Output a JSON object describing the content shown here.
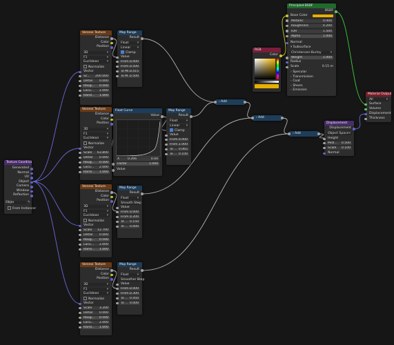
{
  "tex_coord": {
    "title": "Texture Coordinate",
    "outputs": [
      "Generated",
      "Normal",
      "UV",
      "Object",
      "Camera",
      "Window",
      "Reflection"
    ],
    "object_label": "Objec",
    "from_instancer": "From Instancer"
  },
  "voronoi": [
    {
      "title": "Voronoi Texture",
      "outputs": [
        "Distance",
        "Color",
        "Position"
      ],
      "dim": "3D",
      "feature": "F1",
      "metric": "Euclidean",
      "normalize": "Normalize",
      "vector_label": "Vector",
      "fields": [
        [
          "Sc...",
          "200.000"
        ],
        [
          "Detail",
          "0.000"
        ],
        [
          "Roug...",
          "0.500"
        ],
        [
          "Lacu...",
          "2.000"
        ],
        [
          "Rand...",
          "1.000"
        ]
      ]
    },
    {
      "title": "Voronoi Texture",
      "outputs": [
        "Distance",
        "Color",
        "Position"
      ],
      "dim": "3D",
      "feature": "F1",
      "metric": "Euclidean",
      "normalize": "Normalize",
      "vector_label": "Vector",
      "fields": [
        [
          "Scale",
          "63.800"
        ],
        [
          "Detail",
          "0.000"
        ],
        [
          "Roug...",
          "0.500"
        ],
        [
          "Lacu...",
          "2.000"
        ],
        [
          "Rand...",
          "1.000"
        ]
      ]
    },
    {
      "title": "Voronoi Texture",
      "outputs": [
        "Distance",
        "Color",
        "Position"
      ],
      "dim": "3D",
      "feature": "F1",
      "metric": "Euclidean",
      "normalize": "Normalize",
      "vector_label": "Vector",
      "fields": [
        [
          "Scale",
          "12.700"
        ],
        [
          "Detail",
          "0.000"
        ],
        [
          "Roug...",
          "0.500"
        ],
        [
          "Lacu...",
          "2.000"
        ],
        [
          "Rand...",
          "1.000"
        ]
      ]
    },
    {
      "title": "Voronoi Texture",
      "outputs": [
        "Distance",
        "Color",
        "Position"
      ],
      "dim": "3D",
      "feature": "F1",
      "metric": "Euclidean",
      "normalize": "Normalize",
      "vector_label": "Vector",
      "fields": [
        [
          "Scale",
          "3.200"
        ],
        [
          "Detail",
          "0.000"
        ],
        [
          "Roug...",
          "0.500"
        ],
        [
          "Lacu...",
          "2.000"
        ],
        [
          "Rand...",
          "1.000"
        ]
      ]
    }
  ],
  "map_range": [
    {
      "title": "Map Range",
      "result": "Result",
      "dtype": "Float",
      "interp": "Linear",
      "clamp": "Clamp",
      "value_label": "Value",
      "fields": [
        [
          "From...",
          "0.000"
        ],
        [
          "From...",
          "0.500"
        ],
        [
          "To Mi...",
          "0.415"
        ],
        [
          "To M...",
          "0.500"
        ]
      ]
    },
    {
      "title": "Map Range",
      "result": "Result",
      "dtype": "Float",
      "interp": "Linear",
      "clamp": "Clamp",
      "value_label": "Value",
      "fields": [
        [
          "From...",
          "0.000"
        ],
        [
          "From...",
          "1.000"
        ],
        [
          "To ...",
          "0.065"
        ],
        [
          "To ...",
          "0.100"
        ]
      ]
    },
    {
      "title": "Map Range",
      "result": "Result",
      "dtype": "Float",
      "interp": "Smooth Step",
      "clamp": "",
      "value_label": "Value",
      "fields": [
        [
          "From...",
          "0.000"
        ],
        [
          "From...",
          "0.200"
        ],
        [
          "To ...",
          "0.150"
        ],
        [
          "To ...",
          "0.000"
        ]
      ]
    },
    {
      "title": "Map Range",
      "result": "Result",
      "dtype": "Float",
      "interp": "Smoother Step",
      "clamp": "",
      "value_label": "Value",
      "fields": [
        [
          "From...",
          "0.000"
        ],
        [
          "From...",
          "0.300"
        ],
        [
          "To ...",
          "0.450"
        ],
        [
          "To ...",
          "0.000"
        ]
      ]
    }
  ],
  "float_curve": {
    "title": "Float Curve",
    "value_out": "Value",
    "x_label": "X",
    "x_val": "0.266",
    "y_val": "0.00",
    "factor_label": "Factor",
    "factor_val": "1.000",
    "value_in": "Value"
  },
  "add_nodes": [
    {
      "title": "Add"
    },
    {
      "title": "Add"
    },
    {
      "title": "Add"
    }
  ],
  "rgb": {
    "title": "RGB",
    "color_label": "Color"
  },
  "bsdf": {
    "title": "Principled BSDF",
    "out": "BSDF",
    "fields": [
      [
        "Base Color",
        ""
      ],
      [
        "Metallic",
        "0.000"
      ],
      [
        "Roughness",
        "0.200"
      ],
      [
        "IOR",
        "1.500"
      ],
      [
        "Alpha",
        "1.000"
      ]
    ],
    "normal": "Normal",
    "subsurface": "Subsurface",
    "method": "Christensen-Burley",
    "weight": [
      "Weight",
      "1.000"
    ],
    "radius": "Radius",
    "scale": [
      "Scale",
      "0.15 m"
    ],
    "panels": [
      "Specular",
      "Transmission",
      "Coat",
      "Sheen",
      "Emission"
    ]
  },
  "displacement": {
    "title": "Displacement",
    "out": "Displacement",
    "space": "Object Space",
    "height": "Height",
    "fields": [
      [
        "Midl...",
        "0.500"
      ],
      [
        "Scale",
        "0.100"
      ]
    ],
    "normal": "Normal"
  },
  "material_output": {
    "title": "Material Output",
    "target": "All",
    "inputs": [
      "Surface",
      "Volume",
      "Displacement",
      "Thickness"
    ]
  },
  "colors": {
    "wire": "#b5b5b5",
    "vector_wire": "#6a6ad8",
    "shader_wire": "#3fcf3f"
  }
}
